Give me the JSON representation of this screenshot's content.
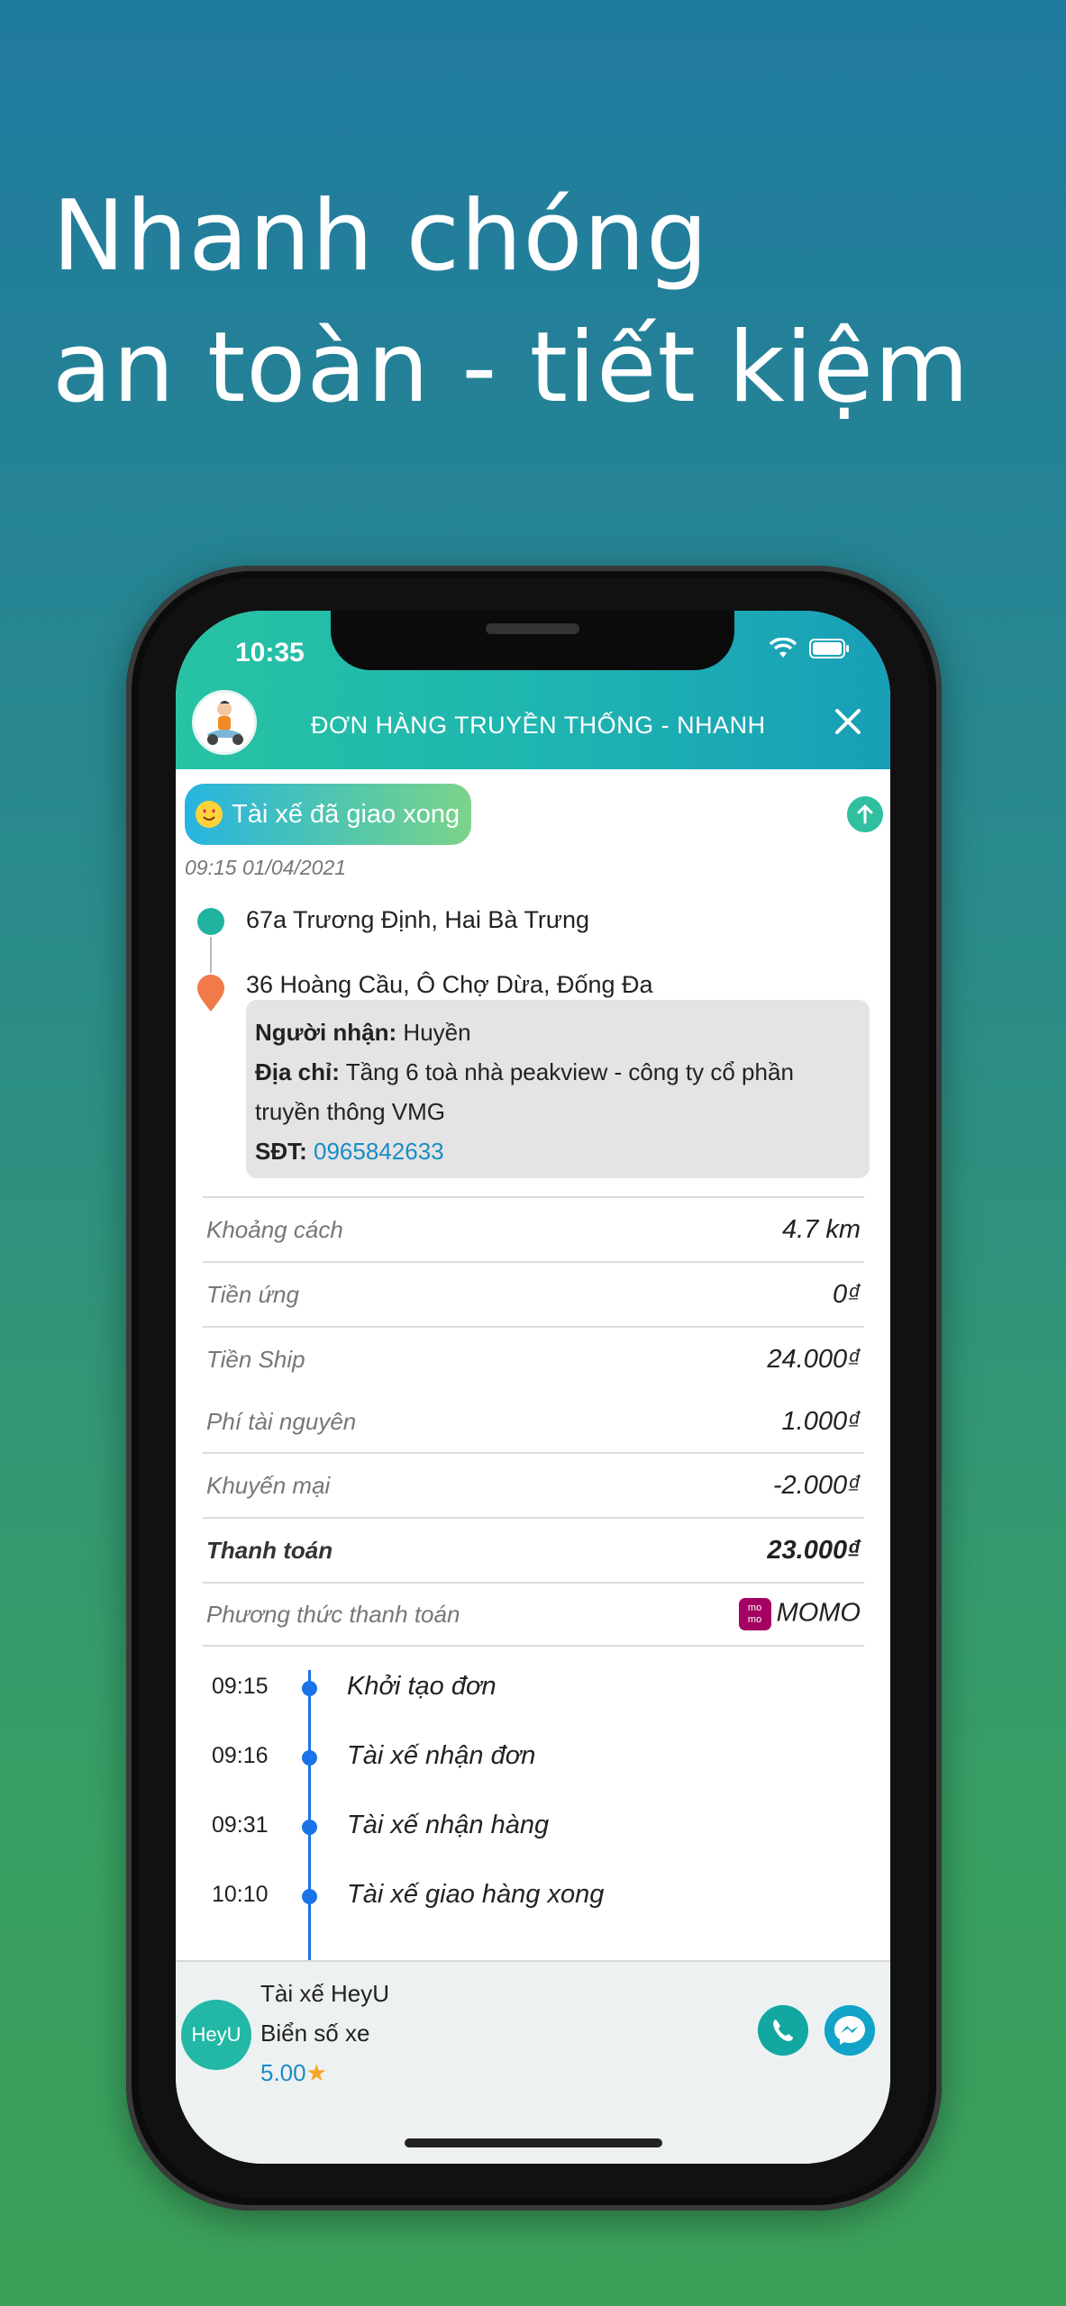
{
  "headline": {
    "line1": "Nhanh chóng",
    "line2": "an toàn - tiết kiệm"
  },
  "status_bar": {
    "time": "10:35"
  },
  "header": {
    "title": "ĐƠN HÀNG TRUYỀN THỐNG - NHANH"
  },
  "order": {
    "status": "Tài xế đã giao xong",
    "datetime": "09:15 01/04/2021",
    "from_address": "67a Trương Định, Hai Bà Trưng",
    "to_address": "36 Hoàng Cầu, Ô Chợ Dừa, Đống Đa",
    "receiver": {
      "name_label": "Người nhận:",
      "name": "Huyền",
      "address_label": "Địa chỉ:",
      "address": "Tầng 6 toà nhà peakview - công ty cổ phần truyền thông VMG",
      "phone_label": "SĐT:",
      "phone": "0965842633"
    },
    "rows": [
      {
        "label": "Khoảng cách",
        "value": "4.7 km"
      },
      {
        "label": "Tiền ứng",
        "value": "0₫"
      },
      {
        "label": "Tiền Ship",
        "value": "24.000₫"
      },
      {
        "label": "Phí tài nguyên",
        "value": "1.000₫"
      },
      {
        "label": "Khuyến mại",
        "value": "-2.000₫"
      },
      {
        "label": "Thanh toán",
        "value": "23.000₫"
      },
      {
        "label": "Phương thức thanh toán",
        "value": "MOMO"
      }
    ],
    "timeline": [
      {
        "time": "09:15",
        "text": "Khởi tạo đơn"
      },
      {
        "time": "09:16",
        "text": "Tài xế nhận đơn"
      },
      {
        "time": "09:31",
        "text": "Tài xế nhận hàng"
      },
      {
        "time": "10:10",
        "text": "Tài xế giao hàng xong"
      }
    ]
  },
  "driver": {
    "avatar_text": "HeyU",
    "name": "Tài xế HeyU",
    "plate": "Biển số xe",
    "rating": "5.00"
  },
  "colors": {
    "accent": "#1fb5b0",
    "link": "#1a8cc6",
    "timeline": "#1a73e8",
    "momo": "#a50064"
  },
  "icons": [
    "wifi-icon",
    "battery-icon",
    "close-icon",
    "arrow-up-icon",
    "emoji-heart-eyes-icon",
    "location-dot-icon",
    "location-pin-icon",
    "momo-icon",
    "star-icon",
    "phone-call-icon",
    "messenger-icon"
  ]
}
